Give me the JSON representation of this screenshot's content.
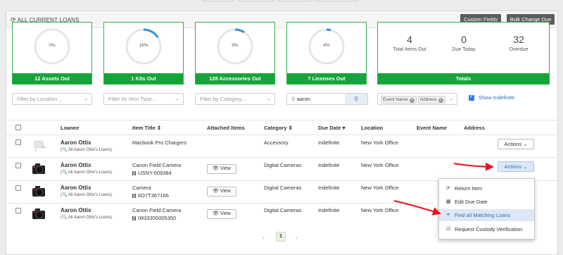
{
  "header": {
    "title": "ALL CURRENT LOANS",
    "custom_fields_label": "Custom Fields",
    "bulk_change_label": "Bulk Change Due"
  },
  "cards": [
    {
      "percent_label": "0%",
      "fraction": 0.0,
      "footer": "12 Assets Out"
    },
    {
      "percent_label": "16%",
      "fraction": 0.16,
      "footer": "1 Kits Out"
    },
    {
      "percent_label": "9%",
      "fraction": 0.09,
      "footer": "128 Accessories Out"
    },
    {
      "percent_label": "4%",
      "fraction": 0.04,
      "footer": "7 Licenses Out"
    }
  ],
  "totals": {
    "total_items_out": "4",
    "total_items_out_label": "Total Items Out",
    "due_today": "0",
    "due_today_label": "Due Today",
    "overdue": "32",
    "overdue_label": "Overdue",
    "footer": "Totals"
  },
  "filters": {
    "location_placeholder": "Filter by Location...",
    "item_type_placeholder": "Filter by Item Type...",
    "category_placeholder": "Filter by Category...",
    "search_value": "aaron",
    "columns_tags": [
      "Event Name",
      "Address"
    ],
    "show_indefinite_label": "Show Indefinite"
  },
  "table": {
    "headers": {
      "loanee": "Loanee",
      "item_title": "Item Title ⇕",
      "attached": "Attached Items",
      "category": "Category ⇕",
      "due_date": "Due Date ▾",
      "location": "Location",
      "event_name": "Event Name",
      "address": "Address"
    },
    "rows": [
      {
        "loanee": "Aaron Ottix",
        "loanee_sub": "(🔍 All Aaron Ottix's Loans)",
        "item_title": "Macbook Pro Chargers",
        "item_code": "",
        "attached": "",
        "category": "Accessory",
        "due_date": "Indefinite",
        "location": "New York Office",
        "actions_label": "Actions ⌄"
      },
      {
        "loanee": "Aaron Ottix",
        "loanee_sub": "(🔍 All Aaron Ottix's Loans)",
        "item_title": "Canon Field Camera",
        "item_code": "USNY-009384",
        "attached": "👁 View",
        "category": "Digital Cameras",
        "due_date": "Indefinite",
        "location": "New York Office",
        "actions_label": "Actions ⌄"
      },
      {
        "loanee": "Aaron Ottix",
        "loanee_sub": "(🔍 All Aaron Ottix's Loans)",
        "item_title": "Camera",
        "item_code": "6O7T367166",
        "attached": "👁 View",
        "category": "Digital Cameras",
        "due_date": "Indefinite",
        "location": "New York Office",
        "actions_label": ""
      },
      {
        "loanee": "Aaron Ottix",
        "loanee_sub": "(🔍 All Aaron Ottix's Loans)",
        "item_title": "Canon Field Camera",
        "item_code": "0833355005350",
        "attached": "👁 View",
        "category": "Digital Cameras",
        "due_date": "Indefinite",
        "location": "New York Office",
        "actions_label": ""
      }
    ]
  },
  "menu": {
    "items": [
      {
        "label": "Return Item",
        "icon": "refresh-icon"
      },
      {
        "label": "Edit Due Date",
        "icon": "calendar-icon"
      },
      {
        "label": "Find all Matching Loans",
        "icon": "binoculars-icon"
      },
      {
        "label": "Request Custody Verification",
        "icon": "checkbox-icon"
      }
    ]
  },
  "pagination": {
    "current_page": "1",
    "prev": "‹",
    "next": "›"
  },
  "colors": {
    "card_border": "#2fb24c",
    "card_footer": "#16a43a",
    "ring_progress": "#2d8fe6",
    "arrow": "#e8141c"
  }
}
